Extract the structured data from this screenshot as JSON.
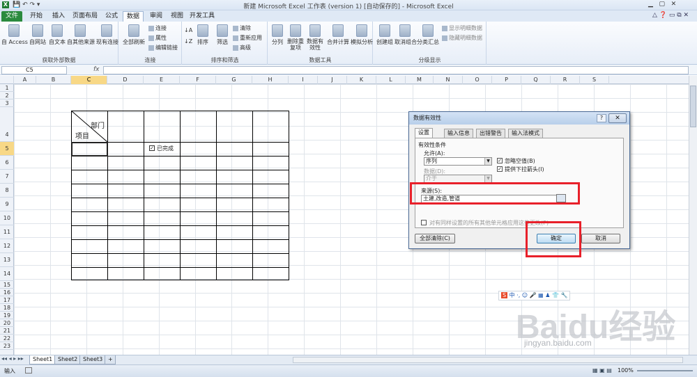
{
  "window": {
    "title": "新建 Microsoft Excel 工作表 (version 1) [自动保存的] - Microsoft Excel"
  },
  "ribbon_tabs": [
    "文件",
    "开始",
    "插入",
    "页面布局",
    "公式",
    "数据",
    "审阅",
    "视图",
    "开发工具"
  ],
  "ribbon_active_tab": "数据",
  "ribbon": {
    "group1": {
      "label": "获取外部数据",
      "btn1": "自 Access",
      "btn2": "自网站",
      "btn3": "自文本",
      "btn4": "自其他来源",
      "btn5": "现有连接"
    },
    "group2": {
      "label": "连接",
      "btn1": "全部刷新",
      "btn2": "连接",
      "btn3": "属性",
      "btn4": "编辑链接"
    },
    "group3": {
      "label": "排序和筛选",
      "btn1": "排序",
      "btn2": "筛选",
      "btn3": "清除",
      "btn4": "重新应用",
      "btn5": "高级"
    },
    "group4": {
      "label": "数据工具",
      "btn1": "分列",
      "btn2": "删除重复项",
      "btn3": "数据有效性",
      "btn4": "合并计算",
      "btn5": "模拟分析"
    },
    "group5": {
      "label": "分级显示",
      "btn1": "创建组",
      "btn2": "取消组合",
      "btn3": "分类汇总",
      "btn4": "显示明细数据",
      "btn5": "隐藏明细数据"
    }
  },
  "formula_bar": {
    "name_box": "C5",
    "fx": "fx"
  },
  "columns": [
    "A",
    "B",
    "C",
    "D",
    "E",
    "F",
    "G",
    "H",
    "I",
    "J",
    "K",
    "L",
    "M",
    "N",
    "O",
    "P",
    "Q",
    "R",
    "S"
  ],
  "selected_column": "C",
  "rows": [
    "1",
    "2",
    "3",
    "4",
    "5",
    "6",
    "7",
    "8",
    "9",
    "10",
    "11",
    "12",
    "13",
    "14",
    "15",
    "16",
    "17",
    "18",
    "19",
    "20",
    "21",
    "22",
    "23"
  ],
  "selected_row": "5",
  "sheet_table": {
    "header_top": "部门",
    "header_bottom": "项目",
    "checkbox_label": "已完成"
  },
  "sheets": [
    "Sheet1",
    "Sheet2",
    "Sheet3"
  ],
  "status": {
    "mode": "输入",
    "zoom": "100%"
  },
  "dialog": {
    "title": "数据有效性",
    "help": "?",
    "close": "✕",
    "tabs": [
      "设置",
      "输入信息",
      "出错警告",
      "输入法模式"
    ],
    "section": "有效性条件",
    "allow_label": "允许(A):",
    "allow_value": "序列",
    "data_label": "数据(D):",
    "data_value": "介于",
    "ignore_blank": "忽略空值(B)",
    "dropdown": "提供下拉箭头(I)",
    "source_label": "来源(S):",
    "source_value": "土建,改造,管道",
    "apply_all": "对有同样设置的所有其他单元格应用这些更改(P)",
    "clear_all": "全部清除(C)",
    "ok": "确定",
    "cancel": "取消"
  },
  "ime_bar": "中",
  "watermark": {
    "text": "Baidu经验",
    "url": "jingyan.baidu.com"
  }
}
